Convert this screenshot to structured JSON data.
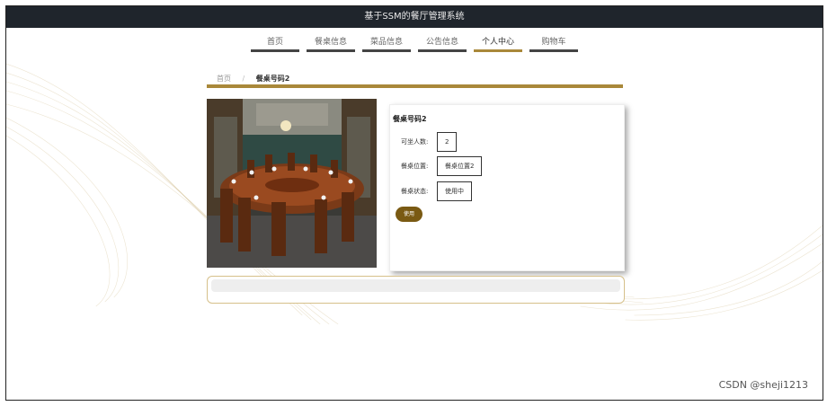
{
  "app": {
    "title": "基于SSM的餐厅管理系统"
  },
  "nav": {
    "items": [
      {
        "label": "首页"
      },
      {
        "label": "餐桌信息"
      },
      {
        "label": "菜品信息"
      },
      {
        "label": "公告信息"
      },
      {
        "label": "个人中心",
        "active": true
      },
      {
        "label": "购物车"
      }
    ]
  },
  "breadcrumb": {
    "home": "首页",
    "separator": "/",
    "current": "餐桌号码2"
  },
  "detail": {
    "title": "餐桌号码2",
    "fields": [
      {
        "label": "可坐人数:",
        "value": "2"
      },
      {
        "label": "餐桌位置:",
        "value": "餐桌位置2"
      },
      {
        "label": "餐桌状态:",
        "value": "使用中"
      }
    ],
    "use_button": "使用"
  },
  "watermark": "CSDN @sheji1213",
  "colors": {
    "accent": "#a9883a",
    "topbar": "#1f252c",
    "button": "#7a5a13"
  }
}
